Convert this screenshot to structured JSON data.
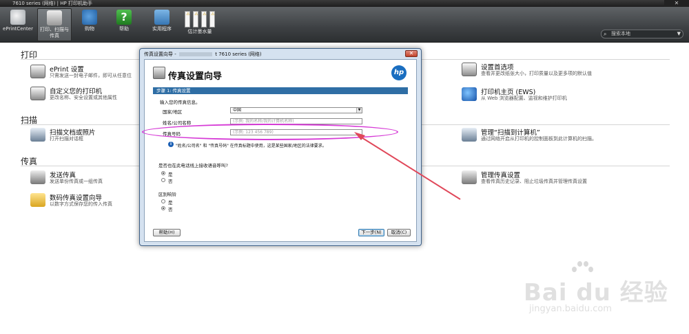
{
  "window": {
    "title": "7610 series (网络) | HP 打印机助手"
  },
  "toolbar": {
    "eprint": "ePrintCenter",
    "print": "打印、扫描与传真",
    "shop": "购物",
    "help": "帮助",
    "tools": "实用程序",
    "ink": "估计墨水量",
    "search_placeholder": "搜索本地"
  },
  "sections": {
    "print": {
      "title": "打印",
      "eprint_title": "ePrint 设置",
      "eprint_desc": "只需发送一封电子邮件，即可从任意位",
      "custom_title": "自定义您的打印机",
      "custom_desc": "更改名称、安全设置或其他属性",
      "pref_title": "设置首选项",
      "pref_desc": "查看并更改纸张大小，打印质量以及更多项的默认值",
      "home_title": "打印机主页 (EWS)",
      "home_desc": "从 Web 浏览器配置、监视和维护打印机"
    },
    "scan": {
      "title": "扫描",
      "doc_title": "扫描文档或照片",
      "doc_desc": "打开扫描对话框",
      "mgr_title": "管理“扫描到计算机”",
      "mgr_desc": "通过网络开启从打印机的控制面板到此计算机的扫描。"
    },
    "fax": {
      "title": "传真",
      "send_title": "发送传真",
      "send_desc": "发送单份传真或一组传真",
      "digital_title": "数码传真设置向导",
      "digital_desc": "以数字方式保存您的传入传真",
      "mgr_title": "管理传真设置",
      "mgr_desc": "查看传真历史记录、阻止垃圾传真并管理传真设置"
    }
  },
  "dialog": {
    "title_prefix": "传真设置向导 -",
    "title_suffix": "t 7610 series (网络)",
    "heading": "传真设置向导",
    "step": "步骤 1: 传真设置",
    "intro": "输入您的传真信息。",
    "country_label": "国家/地区",
    "country_value": "中国",
    "name_label": "姓名/公司名称",
    "name_placeholder": "(示例: 我的名称/我的计算机名称)",
    "fax_label": "传真号码",
    "fax_placeholder": "(示例: 123 456 789)",
    "info": "\"姓名/公司名\" 和 \"传真号码\" 在传真标题中使用，这是某些国家/地区的法律要求。",
    "q1": "是否也在此电话线上接收语音呼叫?",
    "yes": "是",
    "no": "否",
    "q2": "区别响铃",
    "help_btn": "帮助(H)",
    "next_btn": "下一步(N)",
    "cancel_btn": "取消(C)",
    "hp_logo": "hp"
  },
  "watermark": {
    "logo": "Bai du 经验",
    "url": "jingyan.baidu.com"
  },
  "colors": {
    "ellipse": "#d63ad6",
    "arrow": "#e0485a",
    "step_bar": "#2f6ea5"
  }
}
